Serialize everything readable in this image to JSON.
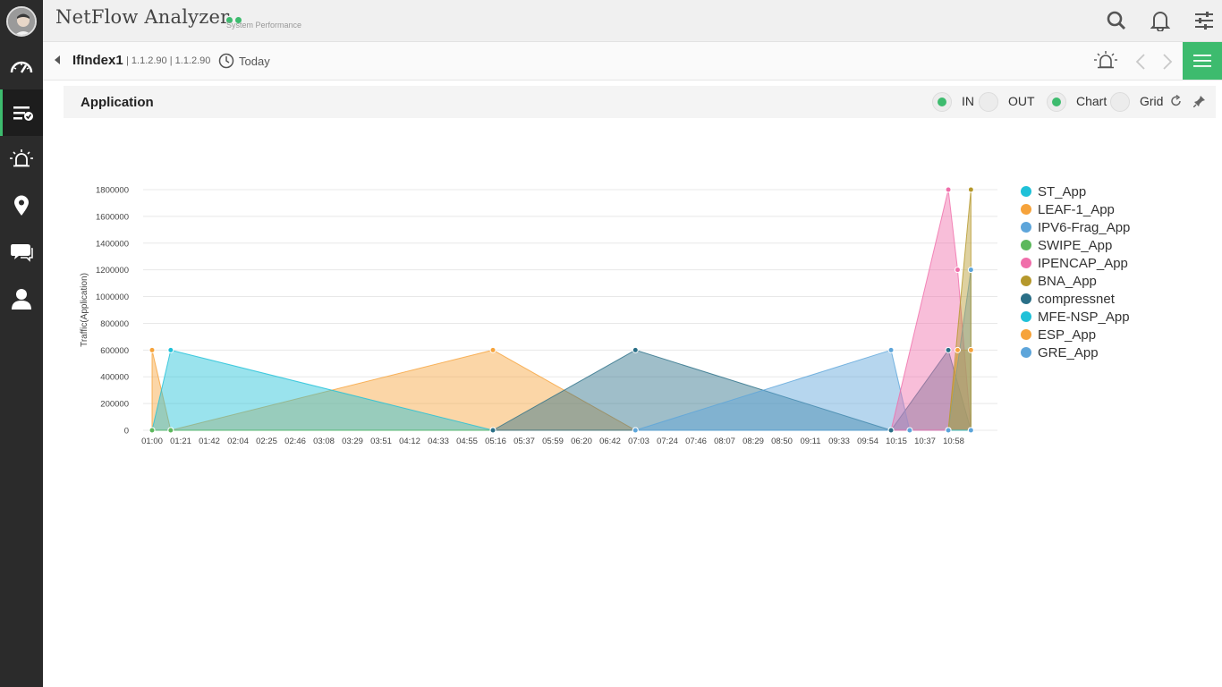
{
  "app": {
    "title": "NetFlow Analyzer",
    "status_label": "System Performance"
  },
  "subbar": {
    "interface": "IfIndex1",
    "ips": "| 1.1.2.90 | 1.1.2.90",
    "period": "Today"
  },
  "panel": {
    "title": "Application",
    "toggles": [
      {
        "label": "IN",
        "on": true
      },
      {
        "label": "OUT",
        "on": false
      },
      {
        "label": "Chart",
        "on": true
      },
      {
        "label": "Grid",
        "on": false
      }
    ]
  },
  "icons": {
    "sidebar": [
      "dashboard-icon",
      "inventory-icon",
      "alarm-icon",
      "location-icon",
      "chat-icon",
      "user-icon"
    ],
    "top": [
      "search-icon",
      "bell-icon",
      "settings-icon"
    ]
  },
  "colors": {
    "accent": "#3dbb6e",
    "sidebar": "#2b2b2b"
  },
  "chart_data": {
    "type": "area",
    "ylabel": "Traffic(Application)",
    "ylim": [
      0,
      1800000
    ],
    "yticks": [
      "0",
      "200000",
      "400000",
      "600000",
      "800000",
      "1000000",
      "1200000",
      "1400000",
      "1600000",
      "1800000"
    ],
    "xticks": [
      "01:00",
      "01:21",
      "01:42",
      "02:04",
      "02:25",
      "02:46",
      "03:08",
      "03:29",
      "03:51",
      "04:12",
      "04:33",
      "04:55",
      "05:16",
      "05:37",
      "05:59",
      "06:20",
      "06:42",
      "07:03",
      "07:24",
      "07:46",
      "08:07",
      "08:29",
      "08:50",
      "09:11",
      "09:33",
      "09:54",
      "10:15",
      "10:37",
      "10:58"
    ],
    "series": [
      {
        "name": "ST_App",
        "color": "#1fc1d8",
        "points": [
          [
            "01:00",
            0
          ],
          [
            "01:14",
            600000
          ],
          [
            "05:16",
            0
          ]
        ]
      },
      {
        "name": "LEAF-1_App",
        "color": "#f6a33b",
        "points": [
          [
            "01:00",
            600000
          ],
          [
            "01:14",
            0
          ],
          [
            "05:16",
            600000
          ],
          [
            "07:03",
            0
          ]
        ]
      },
      {
        "name": "IPV6-Frag_App",
        "color": "#5da5da",
        "points": [
          [
            "07:03",
            0
          ],
          [
            "10:15",
            600000
          ],
          [
            "10:29",
            0
          ],
          [
            "11:15",
            0
          ]
        ]
      },
      {
        "name": "SWIPE_App",
        "color": "#5cb85c",
        "points": [
          [
            "01:00",
            0
          ],
          [
            "01:14",
            0
          ],
          [
            "05:16",
            0
          ]
        ]
      },
      {
        "name": "IPENCAP_App",
        "color": "#f06eaa",
        "points": [
          [
            "10:15",
            0
          ],
          [
            "10:58",
            1800000
          ],
          [
            "11:05",
            1200000
          ],
          [
            "11:15",
            0
          ]
        ]
      },
      {
        "name": "BNA_App",
        "color": "#b5982c",
        "points": [
          [
            "10:58",
            0
          ],
          [
            "11:15",
            1800000
          ],
          [
            "11:15",
            0
          ]
        ]
      },
      {
        "name": "compressnet",
        "color": "#2a6f87",
        "points": [
          [
            "05:16",
            0
          ],
          [
            "07:03",
            600000
          ],
          [
            "10:15",
            0
          ],
          [
            "10:58",
            600000
          ],
          [
            "11:15",
            0
          ]
        ]
      },
      {
        "name": "MFE-NSP_App",
        "color": "#1fc1d8",
        "points": [
          [
            "10:58",
            0
          ],
          [
            "11:15",
            0
          ]
        ]
      },
      {
        "name": "ESP_App",
        "color": "#f6a33b",
        "points": [
          [
            "10:58",
            0
          ],
          [
            "11:05",
            600000
          ],
          [
            "11:15",
            600000
          ]
        ]
      },
      {
        "name": "GRE_App",
        "color": "#5da5da",
        "points": [
          [
            "10:58",
            0
          ],
          [
            "11:15",
            1200000
          ],
          [
            "11:15",
            0
          ]
        ]
      }
    ],
    "legend_position": "right",
    "grid": true
  }
}
